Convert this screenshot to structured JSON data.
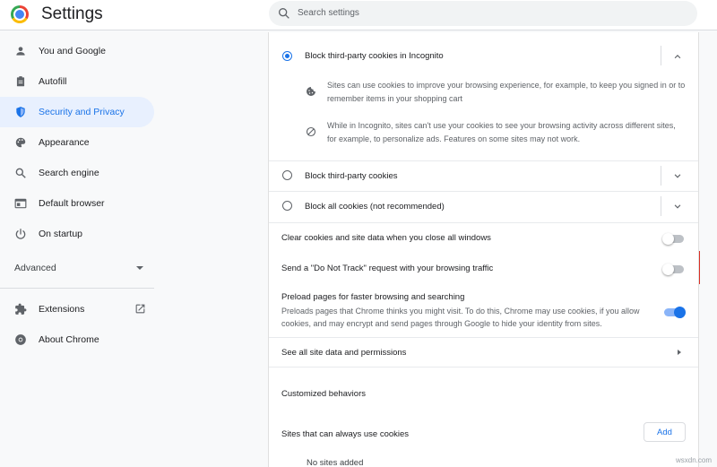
{
  "app": {
    "title": "Settings",
    "logo_icon": "chrome-logo-icon"
  },
  "search": {
    "placeholder": "Search settings",
    "icon": "search-icon"
  },
  "sidebar": {
    "items": [
      {
        "label": "You and Google",
        "icon": "person-icon",
        "active": false
      },
      {
        "label": "Autofill",
        "icon": "clipboard-icon",
        "active": false
      },
      {
        "label": "Security and Privacy",
        "icon": "shield-icon",
        "active": true
      },
      {
        "label": "Appearance",
        "icon": "palette-icon",
        "active": false
      },
      {
        "label": "Search engine",
        "icon": "search-icon",
        "active": false
      },
      {
        "label": "Default browser",
        "icon": "browser-icon",
        "active": false
      },
      {
        "label": "On startup",
        "icon": "power-icon",
        "active": false
      }
    ],
    "advanced": {
      "label": "Advanced",
      "icon": "caret-down-icon"
    },
    "bottom_items": [
      {
        "label": "Extensions",
        "icon": "puzzle-icon",
        "trailing_icon": "open-external-icon"
      },
      {
        "label": "About Chrome",
        "icon": "chrome-icon"
      }
    ]
  },
  "cookies": {
    "options": [
      {
        "label": "Block third-party cookies in Incognito",
        "selected": true,
        "expanded": true,
        "details": [
          {
            "icon": "cookie-icon",
            "text": "Sites can use cookies to improve your browsing experience, for example, to keep you signed in or to remember items in your shopping cart"
          },
          {
            "icon": "block-icon",
            "text": "While in Incognito, sites can't use your cookies to see your browsing activity across different sites, for example, to personalize ads. Features on some sites may not work."
          }
        ]
      },
      {
        "label": "Block third-party cookies",
        "selected": false,
        "expanded": false
      },
      {
        "label": "Block all cookies (not recommended)",
        "selected": false,
        "expanded": false
      }
    ],
    "clear_on_close": {
      "label": "Clear cookies and site data when you close all windows",
      "enabled": false
    },
    "do_not_track": {
      "label": "Send a \"Do Not Track\" request with your browsing traffic",
      "enabled": false,
      "highlighted": true
    },
    "preload": {
      "label": "Preload pages for faster browsing and searching",
      "description": "Preloads pages that Chrome thinks you might visit. To do this, Chrome may use cookies, if you allow cookies, and may encrypt and send pages through Google to hide your identity from sites.",
      "enabled": true
    },
    "see_all": {
      "label": "See all site data and permissions"
    },
    "customized_behaviors": {
      "heading": "Customized behaviors"
    },
    "always_allow": {
      "label": "Sites that can always use cookies",
      "add_label": "Add",
      "empty_text": "No sites added"
    }
  },
  "watermark": "wsxdn.com",
  "colors": {
    "accent": "#1a73e8",
    "highlight_border": "#d93025",
    "active_nav_bg": "#e8f0fe"
  }
}
